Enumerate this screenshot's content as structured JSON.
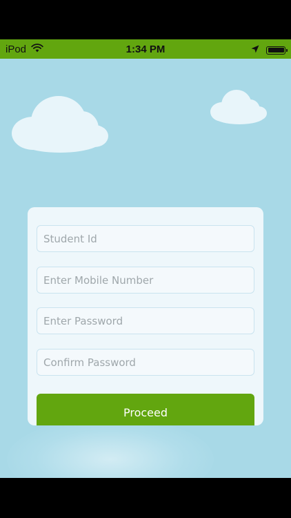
{
  "status_bar": {
    "carrier": "iPod",
    "time": "1:34 PM",
    "wifi_icon": "wifi-icon",
    "location_icon": "location-arrow-icon",
    "battery_icon": "battery-icon",
    "background_color": "#62a60f"
  },
  "form": {
    "student_id_placeholder": "Student Id",
    "mobile_placeholder": "Enter Mobile Number",
    "password_placeholder": "Enter Password",
    "confirm_password_placeholder": "Confirm Password",
    "proceed_label": "Proceed"
  },
  "colors": {
    "accent": "#62a60f",
    "sky": "#a8d9e7",
    "card": "#eef7fb",
    "cloud": "#e8f5fa"
  }
}
